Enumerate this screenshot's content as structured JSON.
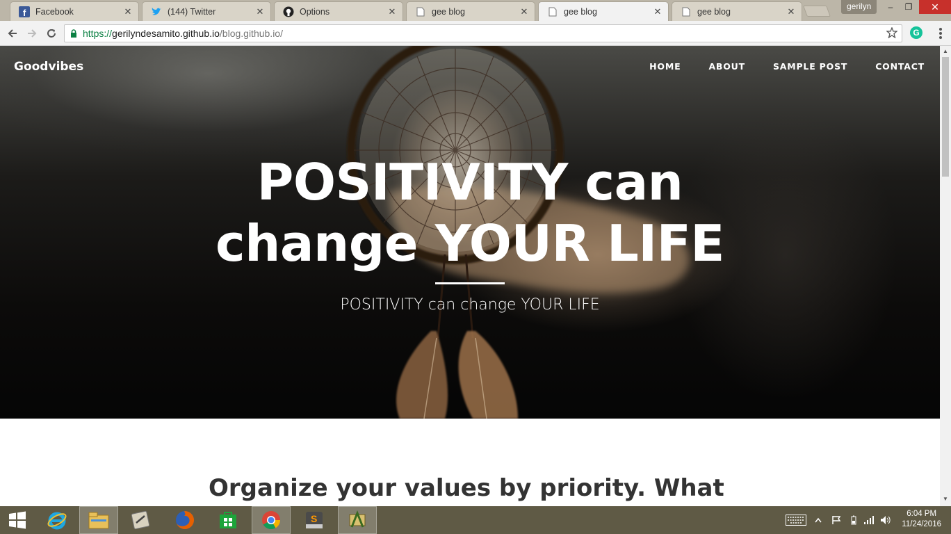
{
  "browser": {
    "tabs": [
      {
        "title": "Facebook",
        "icon": "facebook-icon",
        "active": false
      },
      {
        "title": "(144) Twitter",
        "icon": "twitter-icon",
        "active": false
      },
      {
        "title": "Options",
        "icon": "github-icon",
        "active": false
      },
      {
        "title": "gee blog",
        "icon": "page-icon",
        "active": false
      },
      {
        "title": "gee blog",
        "icon": "page-icon",
        "active": true
      },
      {
        "title": "gee blog",
        "icon": "page-icon",
        "active": false
      }
    ],
    "profile_name": "gerilyn",
    "url": {
      "scheme": "https://",
      "host": "gerilyndesamito.github.io",
      "path": "/blog.github.io/"
    },
    "extension_letter": "G"
  },
  "site": {
    "brand": "Goodvibes",
    "nav": [
      "HOME",
      "ABOUT",
      "SAMPLE POST",
      "CONTACT"
    ],
    "hero": {
      "title_line1": "POSITIVITY can",
      "title_line2": "change YOUR LIFE",
      "subtitle": "POSITIVITY can change YOUR LIFE"
    },
    "post_heading": "Organize your values by priority. What"
  },
  "taskbar": {
    "apps": [
      "start-icon",
      "internet-explorer-icon",
      "file-explorer-icon",
      "tool-icon",
      "firefox-icon",
      "store-icon",
      "chrome-icon",
      "sublime-text-icon",
      "app-icon"
    ],
    "time": "6:04 PM",
    "date": "11/24/2016"
  },
  "colors": {
    "accent_secure": "#0b8043",
    "taskbar": "#5f5a45",
    "close_button": "#c7302b"
  }
}
